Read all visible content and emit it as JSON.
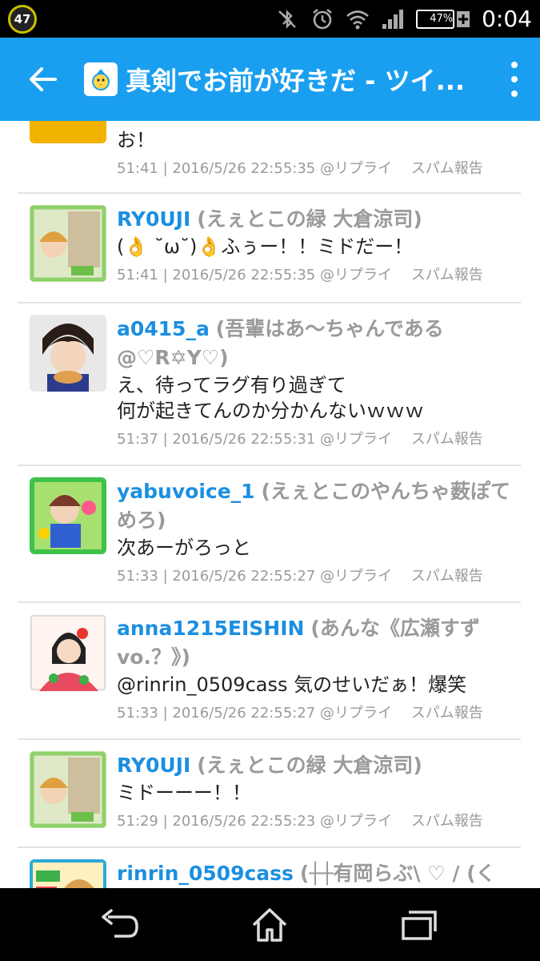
{
  "status_bar": {
    "badge": "47",
    "battery": "47%",
    "battery_level": 0.47,
    "time": "0:04"
  },
  "app_bar": {
    "title": "真剣でお前が好きだ - ツイ..."
  },
  "tweets": [
    {
      "username": "",
      "display_name": "",
      "body": "お！",
      "timestamp": "51:41 | 2016/5/26 22:55:35",
      "reply": "@リプライ",
      "spam": "スパム報告",
      "avatar_color": "#f2b200"
    },
    {
      "username": "RY0UJI",
      "display_name": "(えぇとこの緑 大倉涼司)",
      "body": "(👌 ˘ω˘)👌ふぅー！！ミドだー！",
      "timestamp": "51:41 | 2016/5/26 22:55:35",
      "reply": "@リプライ",
      "spam": "スパム報告",
      "avatar_color": "#8fd16a"
    },
    {
      "username": "a0415_a",
      "display_name": "(吾輩はあ～ちゃんである@♡R✡Y♡)",
      "body": "え、待ってラグ有り過ぎて\n何が起きてんのか分かんないｗｗｗ",
      "timestamp": "51:37 | 2016/5/26 22:55:31",
      "reply": "@リプライ",
      "spam": "スパム報告",
      "avatar_color": "#3a2a22"
    },
    {
      "username": "yabuvoice_1",
      "display_name": "(えぇとこのやんちゃ薮ぽてめろ)",
      "body": "次あーがろっと",
      "timestamp": "51:33 | 2016/5/26 22:55:27",
      "reply": "@リプライ",
      "spam": "スパム報告",
      "avatar_color": "#3ec24a"
    },
    {
      "username": "anna1215EISHIN",
      "display_name": "(あんな《広瀬すずvo.？》)",
      "body": "@rinrin_0509cass 気のせいだぁ！爆笑",
      "timestamp": "51:33 | 2016/5/26 22:55:27",
      "reply": "@リプライ",
      "spam": "スパム報告",
      "avatar_color": "#e84a5f"
    },
    {
      "username": "RY0UJI",
      "display_name": "(えぇとこの緑 大倉涼司)",
      "body": "ミドーーー！！",
      "timestamp": "51:29 | 2016/5/26 22:55:23",
      "reply": "@リプライ",
      "spam": "スパム報告",
      "avatar_color": "#8fd16a"
    },
    {
      "username": "rinrin_0509cass",
      "display_name": "(┼┼有岡らぶ\\ ♡ / (く",
      "body": "",
      "timestamp": "",
      "reply": "",
      "spam": "",
      "avatar_color": "#2ba8d8"
    }
  ]
}
